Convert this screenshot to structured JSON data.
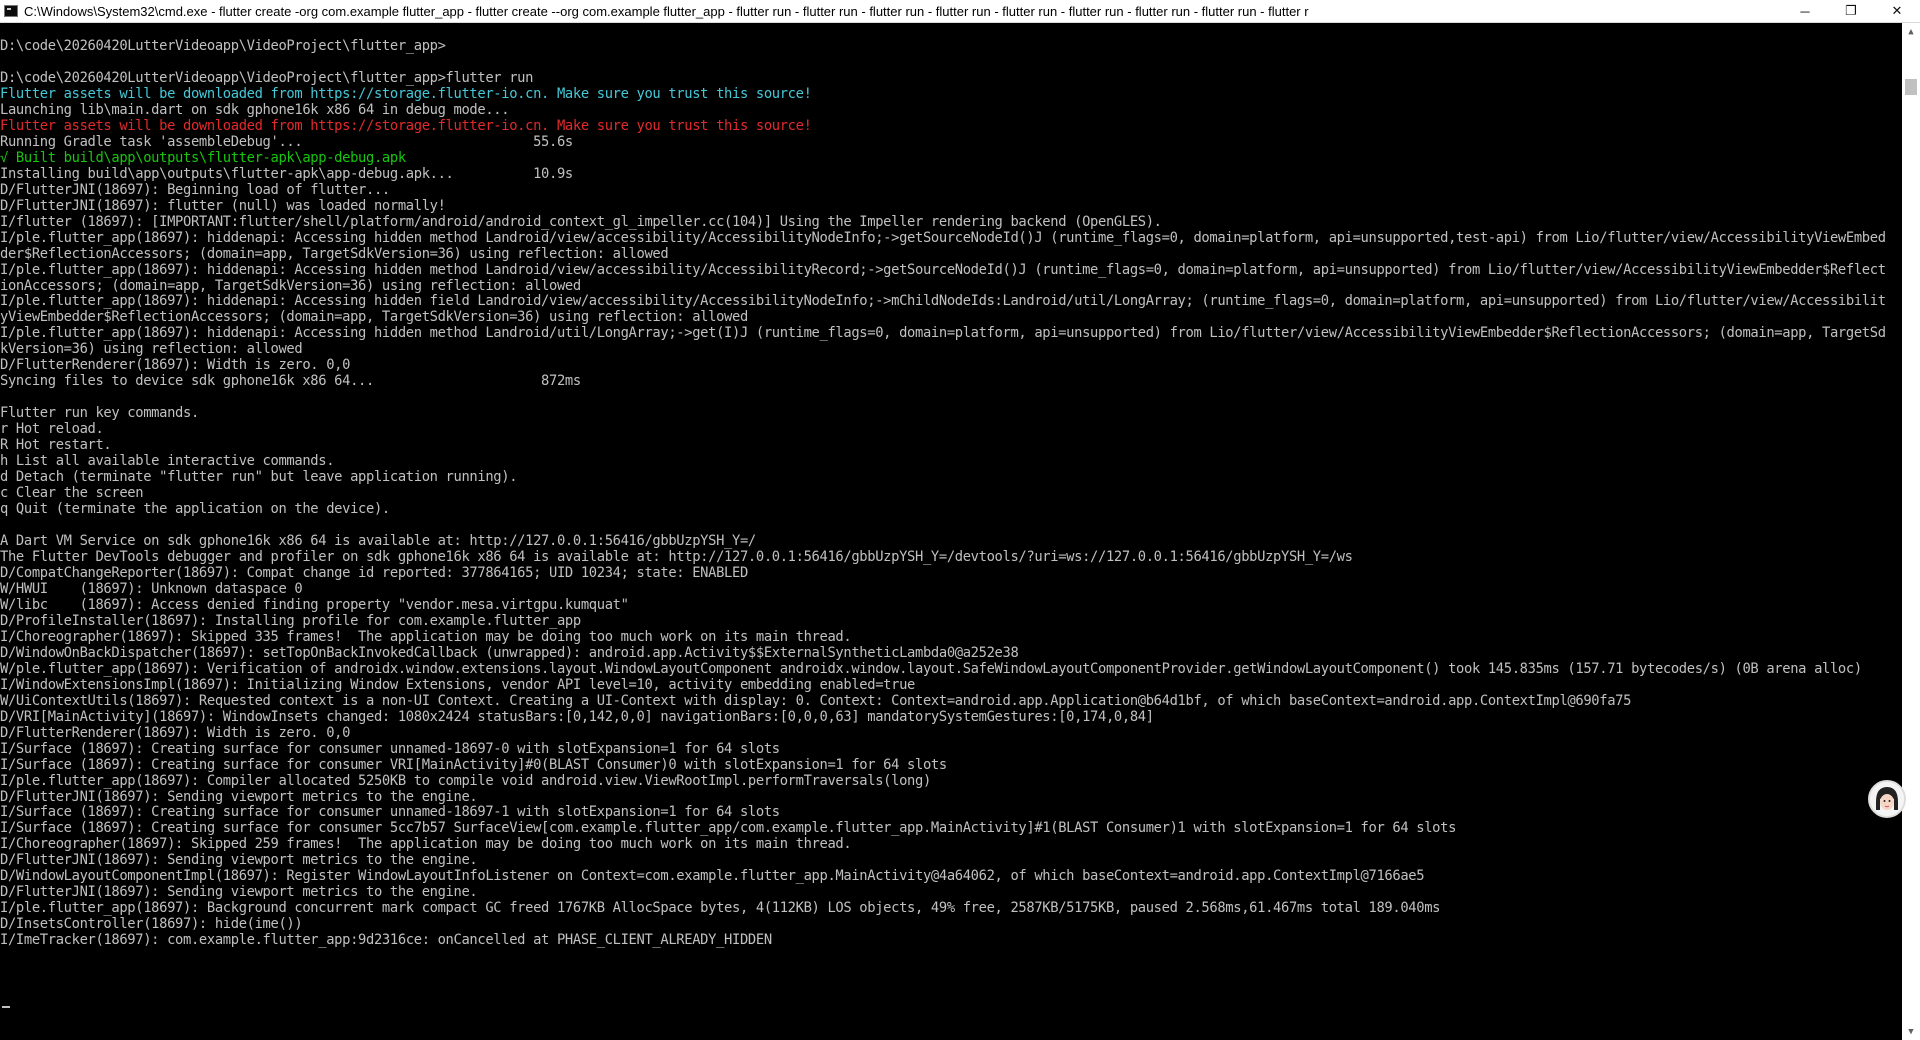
{
  "window": {
    "title": "C:\\Windows\\System32\\cmd.exe - flutter  create -org com.example flutter_app - flutter  create --org com.example flutter_app - flutter  run - flutter  run - flutter  run - flutter  run - flutter  run - flutter  run - flutter  run - flutter  run - flutter  r",
    "icon": "cmd-icon",
    "minimize_glyph": "─",
    "maximize_glyph": "❐",
    "close_glyph": "✕"
  },
  "colors": {
    "background": "#000000",
    "text": "#c0c0c0",
    "info": "#45c8d8",
    "error": "#e22a2a",
    "success": "#16c60c"
  },
  "console": {
    "lines": [
      "",
      "D:\\code\\20260420LutterVideoapp\\VideoProject\\flutter_app>",
      "",
      "D:\\code\\20260420LutterVideoapp\\VideoProject\\flutter_app>flutter run",
      "Flutter assets will be downloaded from https://storage.flutter-io.cn. Make sure you trust this source!",
      "Launching lib\\main.dart on sdk gphone16k x86 64 in debug mode...",
      "Flutter assets will be downloaded from https://storage.flutter-io.cn. Make sure you trust this source!",
      "Running Gradle task 'assembleDebug'...                             55.6s",
      "√ Built build\\app\\outputs\\flutter-apk\\app-debug.apk",
      "Installing build\\app\\outputs\\flutter-apk\\app-debug.apk...          10.9s",
      "D/FlutterJNI(18697): Beginning load of flutter...",
      "D/FlutterJNI(18697): flutter (null) was loaded normally!",
      "I/flutter (18697): [IMPORTANT:flutter/shell/platform/android/android_context_gl_impeller.cc(104)] Using the Impeller rendering backend (OpenGLES).",
      "I/ple.flutter_app(18697): hiddenapi: Accessing hidden method Landroid/view/accessibility/AccessibilityNodeInfo;->getSourceNodeId()J (runtime_flags=0, domain=platform, api=unsupported,test-api) from Lio/flutter/view/AccessibilityViewEmbed",
      "der$ReflectionAccessors; (domain=app, TargetSdkVersion=36) using reflection: allowed",
      "I/ple.flutter_app(18697): hiddenapi: Accessing hidden method Landroid/view/accessibility/AccessibilityRecord;->getSourceNodeId()J (runtime_flags=0, domain=platform, api=unsupported) from Lio/flutter/view/AccessibilityViewEmbedder$Reflect",
      "ionAccessors; (domain=app, TargetSdkVersion=36) using reflection: allowed",
      "I/ple.flutter_app(18697): hiddenapi: Accessing hidden field Landroid/view/accessibility/AccessibilityNodeInfo;->mChildNodeIds:Landroid/util/LongArray; (runtime_flags=0, domain=platform, api=unsupported) from Lio/flutter/view/Accessibilit",
      "yViewEmbedder$ReflectionAccessors; (domain=app, TargetSdkVersion=36) using reflection: allowed",
      "I/ple.flutter_app(18697): hiddenapi: Accessing hidden method Landroid/util/LongArray;->get(I)J (runtime_flags=0, domain=platform, api=unsupported) from Lio/flutter/view/AccessibilityViewEmbedder$ReflectionAccessors; (domain=app, TargetSd",
      "kVersion=36) using reflection: allowed",
      "D/FlutterRenderer(18697): Width is zero. 0,0",
      "Syncing files to device sdk gphone16k x86 64...                     872ms",
      "",
      "Flutter run key commands.",
      "r Hot reload.",
      "R Hot restart.",
      "h List all available interactive commands.",
      "d Detach (terminate \"flutter run\" but leave application running).",
      "c Clear the screen",
      "q Quit (terminate the application on the device).",
      "",
      "A Dart VM Service on sdk gphone16k x86 64 is available at: http://127.0.0.1:56416/gbbUzpYSH_Y=/",
      "The Flutter DevTools debugger and profiler on sdk gphone16k x86 64 is available at: http://127.0.0.1:56416/gbbUzpYSH_Y=/devtools/?uri=ws://127.0.0.1:56416/gbbUzpYSH_Y=/ws",
      "D/CompatChangeReporter(18697): Compat change id reported: 377864165; UID 10234; state: ENABLED",
      "W/HWUI    (18697): Unknown dataspace 0",
      "W/libc    (18697): Access denied finding property \"vendor.mesa.virtgpu.kumquat\"",
      "D/ProfileInstaller(18697): Installing profile for com.example.flutter_app",
      "I/Choreographer(18697): Skipped 335 frames!  The application may be doing too much work on its main thread.",
      "D/WindowOnBackDispatcher(18697): setTopOnBackInvokedCallback (unwrapped): android.app.Activity$$ExternalSyntheticLambda0@a252e38",
      "W/ple.flutter_app(18697): Verification of androidx.window.extensions.layout.WindowLayoutComponent androidx.window.layout.SafeWindowLayoutComponentProvider.getWindowLayoutComponent() took 145.835ms (157.71 bytecodes/s) (0B arena alloc)",
      "I/WindowExtensionsImpl(18697): Initializing Window Extensions, vendor API level=10, activity embedding enabled=true",
      "W/UiContextUtils(18697): Requested context is a non-UI Context. Creating a UI-Context with display: 0. Context: Context=android.app.Application@b64d1bf, of which baseContext=android.app.ContextImpl@690fa75",
      "D/VRI[MainActivity](18697): WindowInsets changed: 1080x2424 statusBars:[0,142,0,0] navigationBars:[0,0,0,63] mandatorySystemGestures:[0,174,0,84]",
      "D/FlutterRenderer(18697): Width is zero. 0,0",
      "I/Surface (18697): Creating surface for consumer unnamed-18697-0 with slotExpansion=1 for 64 slots",
      "I/Surface (18697): Creating surface for consumer VRI[MainActivity]#0(BLAST Consumer)0 with slotExpansion=1 for 64 slots",
      "I/ple.flutter_app(18697): Compiler allocated 5250KB to compile void android.view.ViewRootImpl.performTraversals(long)",
      "D/FlutterJNI(18697): Sending viewport metrics to the engine.",
      "I/Surface (18697): Creating surface for consumer unnamed-18697-1 with slotExpansion=1 for 64 slots",
      "I/Surface (18697): Creating surface for consumer 5cc7b57 SurfaceView[com.example.flutter_app/com.example.flutter_app.MainActivity]#1(BLAST Consumer)1 with slotExpansion=1 for 64 slots",
      "I/Choreographer(18697): Skipped 259 frames!  The application may be doing too much work on its main thread.",
      "D/FlutterJNI(18697): Sending viewport metrics to the engine.",
      "D/WindowLayoutComponentImpl(18697): Register WindowLayoutInfoListener on Context=com.example.flutter_app.MainActivity@4a64062, of which baseContext=android.app.ContextImpl@7166ae5",
      "D/FlutterJNI(18697): Sending viewport metrics to the engine.",
      "I/ple.flutter_app(18697): Background concurrent mark compact GC freed 1767KB AllocSpace bytes, 4(112KB) LOS objects, 49% free, 2587KB/5175KB, paused 2.568ms,61.467ms total 189.040ms",
      "D/InsetsController(18697): hide(ime())",
      "I/ImeTracker(18697): com.example.flutter_app:9d2316ce: onCancelled at PHASE_CLIENT_ALREADY_HIDDEN"
    ],
    "line_colors": {
      "4": "cyan",
      "6": "red",
      "8": "green"
    }
  },
  "scrollbar": {
    "up_glyph": "▲",
    "down_glyph": "▼"
  }
}
